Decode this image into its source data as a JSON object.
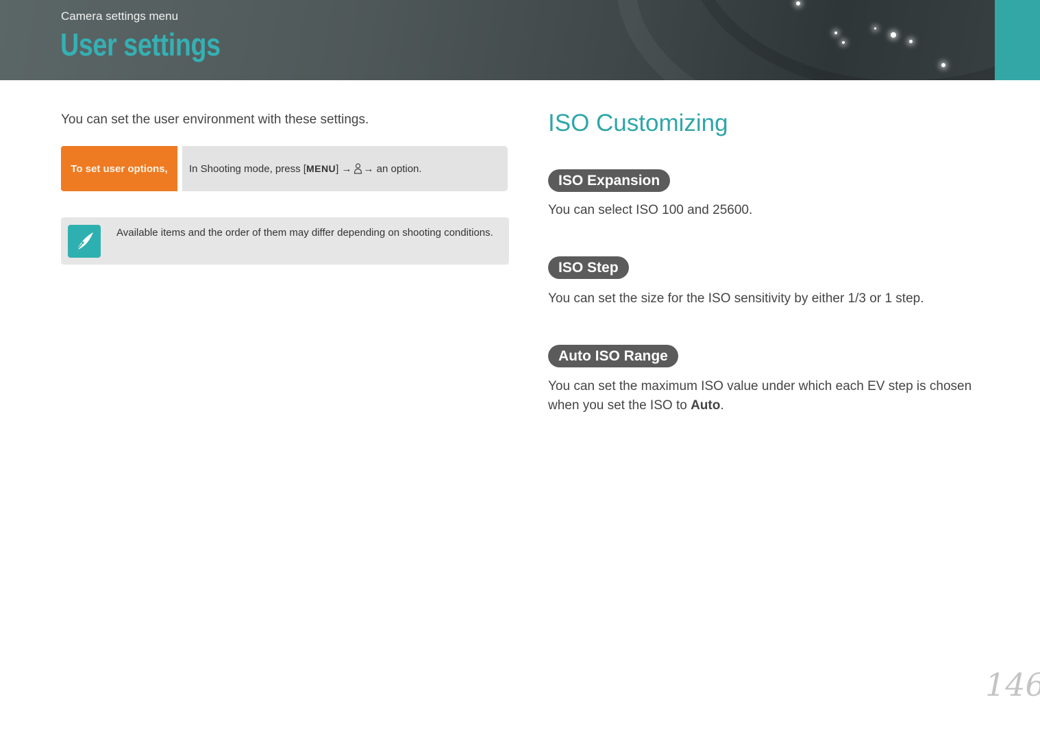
{
  "header": {
    "breadcrumb": "Camera settings menu",
    "title": "User settings",
    "accent_color": "#33a6a6"
  },
  "intro": "You can set the user environment with these settings.",
  "howto": {
    "label": "To set user options,",
    "prefix": "In Shooting mode, press [",
    "menu_key": "MENU",
    "middle": "] → ",
    "user_icon": "user-icon",
    "suffix": " → an option.",
    "label_color": "#ee7b22"
  },
  "note": {
    "icon": "pen-note-icon",
    "text": "Available items and the order of them may differ depending on shooting conditions."
  },
  "section": {
    "title": "ISO Customizing",
    "items": [
      {
        "heading": "ISO Expansion",
        "text": "You can select ISO 100 and 25600."
      },
      {
        "heading": "ISO Step",
        "text": "You can set the size for the ISO sensitivity by either 1/3 or 1 step."
      },
      {
        "heading": "Auto ISO Range",
        "text_before": "You can set the maximum ISO value under which each EV step is chosen when you set the ISO to ",
        "text_bold": "Auto",
        "text_after": "."
      }
    ]
  },
  "page_number": "146"
}
